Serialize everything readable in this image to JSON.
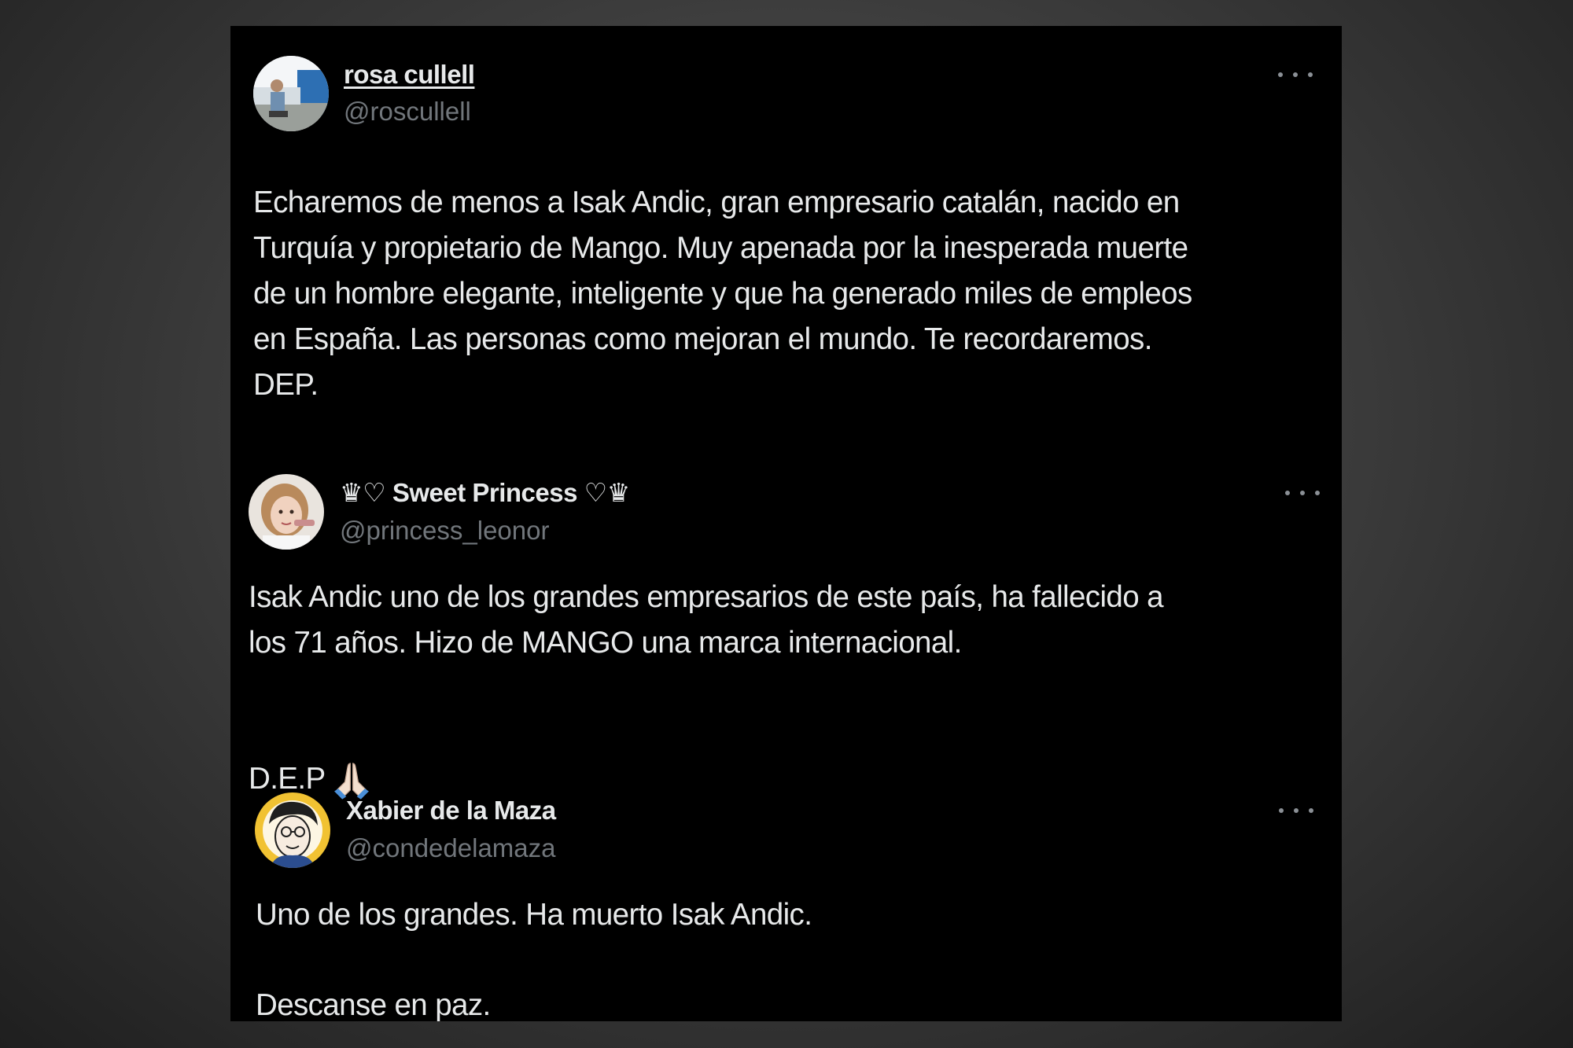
{
  "tweets": [
    {
      "display_name": "rosa cullell",
      "handle": "@roscullell",
      "text": "Echaremos de menos a Isak Andic, gran empresario catalán, nacido en\nTurquía y propietario de Mango.  Muy apenada por la inesperada muerte\nde un hombre elegante, inteligente y que ha generado miles de empleos\nen España. Las personas como mejoran el mundo. Te recordaremos.\nDEP."
    },
    {
      "display_name": "♛♡ Sweet Princess ♡♛",
      "handle": "@princess_leonor",
      "text": "Isak Andic uno de los grandes empresarios de este país, ha fallecido a\nlos 71 años. Hizo de MANGO una marca internacional.",
      "closing": "D.E.P"
    },
    {
      "display_name": "Xabier de la Maza",
      "handle": "@condedelamaza",
      "text": "Uno de los grandes. Ha muerto Isak Andic.",
      "closing": "Descanse en paz."
    }
  ],
  "icons": {
    "more": "more-options-icon",
    "pray": "folded-hands-emoji"
  },
  "colors": {
    "background": "#000000",
    "text": "#e7e9ea",
    "handle": "#71767b"
  }
}
